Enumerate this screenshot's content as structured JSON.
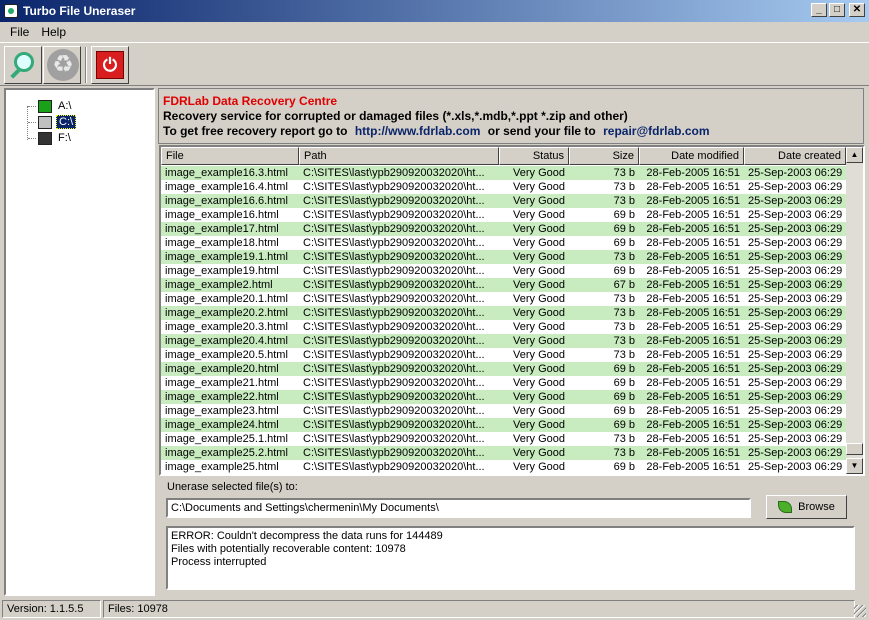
{
  "window": {
    "title": "Turbo File Uneraser"
  },
  "menu": [
    {
      "label": "File"
    },
    {
      "label": "Help"
    }
  ],
  "toolbar": {
    "icons": [
      "search-icon",
      "recycle-icon",
      "power-icon"
    ]
  },
  "drives": [
    {
      "label": "A:\\",
      "icon": "floppy-drive-icon",
      "selected": false
    },
    {
      "label": "C:\\",
      "icon": "hard-drive-icon",
      "selected": true
    },
    {
      "label": "F:\\",
      "icon": "cd-drive-icon",
      "selected": false
    }
  ],
  "banner": {
    "title": "FDRLab Data Recovery Centre",
    "line1": "Recovery service for corrupted or damaged files (*.xls,*.mdb,*.ppt *.zip and other)",
    "line2_prefix": "To get free recovery report go to",
    "url": "http://www.fdrlab.com",
    "line2_middle": "or send your file to",
    "email": "repair@fdrlab.com",
    "title_color": "#e00000",
    "link_color": "#0a246a"
  },
  "file_list": {
    "columns": [
      "File",
      "Path",
      "Status",
      "Size",
      "Date modified",
      "Date created"
    ],
    "row_highlight_color": "#c8ecc0",
    "rows": [
      {
        "file": "image_example16.3.html",
        "path": "C:\\SITES\\last\\ypb290920032020\\ht...",
        "status": "Very Good",
        "size": "73 b",
        "modified": "28-Feb-2005 16:51",
        "created": "25-Sep-2003 06:29"
      },
      {
        "file": "image_example16.4.html",
        "path": "C:\\SITES\\last\\ypb290920032020\\ht...",
        "status": "Very Good",
        "size": "73 b",
        "modified": "28-Feb-2005 16:51",
        "created": "25-Sep-2003 06:29"
      },
      {
        "file": "image_example16.6.html",
        "path": "C:\\SITES\\last\\ypb290920032020\\ht...",
        "status": "Very Good",
        "size": "73 b",
        "modified": "28-Feb-2005 16:51",
        "created": "25-Sep-2003 06:29"
      },
      {
        "file": "image_example16.html",
        "path": "C:\\SITES\\last\\ypb290920032020\\ht...",
        "status": "Very Good",
        "size": "69 b",
        "modified": "28-Feb-2005 16:51",
        "created": "25-Sep-2003 06:29"
      },
      {
        "file": "image_example17.html",
        "path": "C:\\SITES\\last\\ypb290920032020\\ht...",
        "status": "Very Good",
        "size": "69 b",
        "modified": "28-Feb-2005 16:51",
        "created": "25-Sep-2003 06:29"
      },
      {
        "file": "image_example18.html",
        "path": "C:\\SITES\\last\\ypb290920032020\\ht...",
        "status": "Very Good",
        "size": "69 b",
        "modified": "28-Feb-2005 16:51",
        "created": "25-Sep-2003 06:29"
      },
      {
        "file": "image_example19.1.html",
        "path": "C:\\SITES\\last\\ypb290920032020\\ht...",
        "status": "Very Good",
        "size": "73 b",
        "modified": "28-Feb-2005 16:51",
        "created": "25-Sep-2003 06:29"
      },
      {
        "file": "image_example19.html",
        "path": "C:\\SITES\\last\\ypb290920032020\\ht...",
        "status": "Very Good",
        "size": "69 b",
        "modified": "28-Feb-2005 16:51",
        "created": "25-Sep-2003 06:29"
      },
      {
        "file": "image_example2.html",
        "path": "C:\\SITES\\last\\ypb290920032020\\ht...",
        "status": "Very Good",
        "size": "67 b",
        "modified": "28-Feb-2005 16:51",
        "created": "25-Sep-2003 06:29"
      },
      {
        "file": "image_example20.1.html",
        "path": "C:\\SITES\\last\\ypb290920032020\\ht...",
        "status": "Very Good",
        "size": "73 b",
        "modified": "28-Feb-2005 16:51",
        "created": "25-Sep-2003 06:29"
      },
      {
        "file": "image_example20.2.html",
        "path": "C:\\SITES\\last\\ypb290920032020\\ht...",
        "status": "Very Good",
        "size": "73 b",
        "modified": "28-Feb-2005 16:51",
        "created": "25-Sep-2003 06:29"
      },
      {
        "file": "image_example20.3.html",
        "path": "C:\\SITES\\last\\ypb290920032020\\ht...",
        "status": "Very Good",
        "size": "73 b",
        "modified": "28-Feb-2005 16:51",
        "created": "25-Sep-2003 06:29"
      },
      {
        "file": "image_example20.4.html",
        "path": "C:\\SITES\\last\\ypb290920032020\\ht...",
        "status": "Very Good",
        "size": "73 b",
        "modified": "28-Feb-2005 16:51",
        "created": "25-Sep-2003 06:29"
      },
      {
        "file": "image_example20.5.html",
        "path": "C:\\SITES\\last\\ypb290920032020\\ht...",
        "status": "Very Good",
        "size": "73 b",
        "modified": "28-Feb-2005 16:51",
        "created": "25-Sep-2003 06:29"
      },
      {
        "file": "image_example20.html",
        "path": "C:\\SITES\\last\\ypb290920032020\\ht...",
        "status": "Very Good",
        "size": "69 b",
        "modified": "28-Feb-2005 16:51",
        "created": "25-Sep-2003 06:29"
      },
      {
        "file": "image_example21.html",
        "path": "C:\\SITES\\last\\ypb290920032020\\ht...",
        "status": "Very Good",
        "size": "69 b",
        "modified": "28-Feb-2005 16:51",
        "created": "25-Sep-2003 06:29"
      },
      {
        "file": "image_example22.html",
        "path": "C:\\SITES\\last\\ypb290920032020\\ht...",
        "status": "Very Good",
        "size": "69 b",
        "modified": "28-Feb-2005 16:51",
        "created": "25-Sep-2003 06:29"
      },
      {
        "file": "image_example23.html",
        "path": "C:\\SITES\\last\\ypb290920032020\\ht...",
        "status": "Very Good",
        "size": "69 b",
        "modified": "28-Feb-2005 16:51",
        "created": "25-Sep-2003 06:29"
      },
      {
        "file": "image_example24.html",
        "path": "C:\\SITES\\last\\ypb290920032020\\ht...",
        "status": "Very Good",
        "size": "69 b",
        "modified": "28-Feb-2005 16:51",
        "created": "25-Sep-2003 06:29"
      },
      {
        "file": "image_example25.1.html",
        "path": "C:\\SITES\\last\\ypb290920032020\\ht...",
        "status": "Very Good",
        "size": "73 b",
        "modified": "28-Feb-2005 16:51",
        "created": "25-Sep-2003 06:29"
      },
      {
        "file": "image_example25.2.html",
        "path": "C:\\SITES\\last\\ypb290920032020\\ht...",
        "status": "Very Good",
        "size": "73 b",
        "modified": "28-Feb-2005 16:51",
        "created": "25-Sep-2003 06:29"
      },
      {
        "file": "image_example25.html",
        "path": "C:\\SITES\\last\\ypb290920032020\\ht...",
        "status": "Very Good",
        "size": "69 b",
        "modified": "28-Feb-2005 16:51",
        "created": "25-Sep-2003 06:29"
      }
    ]
  },
  "destination": {
    "label": "Unerase selected file(s) to:",
    "value": "C:\\Documents and Settings\\chermenin\\My Documents\\",
    "browse_label": "Browse"
  },
  "log": {
    "lines": [
      "ERROR: Couldn't decompress the data runs for 144489",
      "Files with potentially recoverable content: 10978",
      "Process interrupted"
    ]
  },
  "status": {
    "version": "Version: 1.1.5.5",
    "files": "Files: 10978"
  }
}
